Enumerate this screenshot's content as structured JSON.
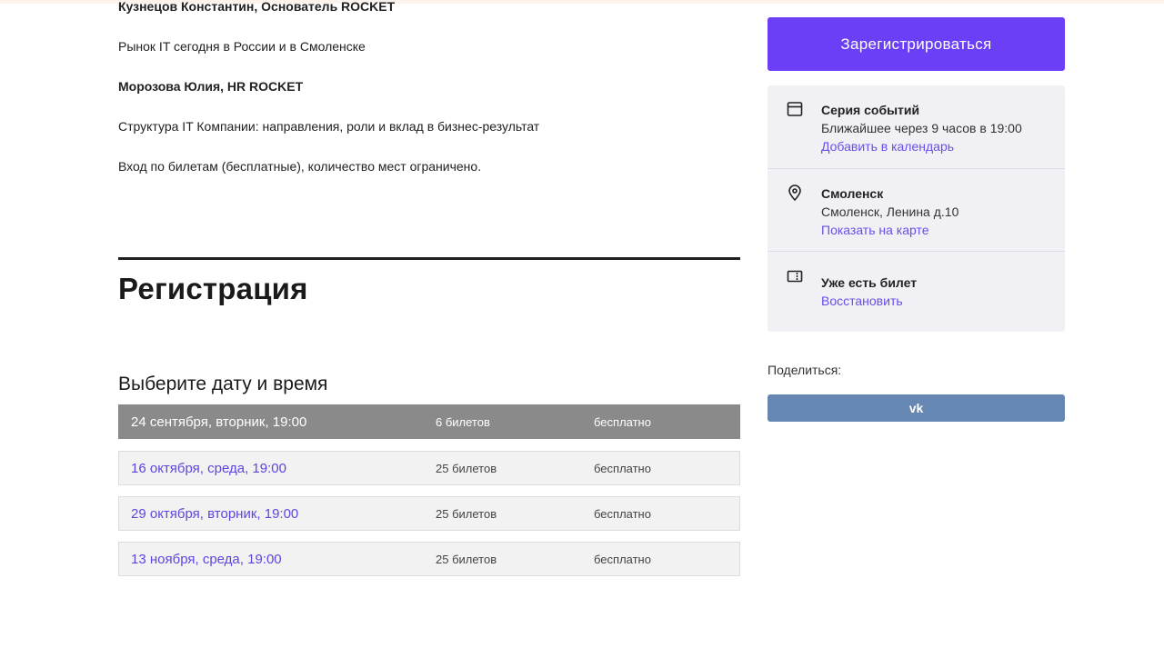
{
  "program": {
    "speaker1": "Кузнецов Константин, Основатель ROCKET",
    "talk1": "Рынок IT сегодня в России и в Смоленске",
    "speaker2": "Морозова Юлия, HR ROCKET",
    "talk2": "Структура IT Компании: направления, роли и вклад в бизнес-результат",
    "entry_note": "Вход по билетам (бесплатные), количество мест ограничено."
  },
  "registration": {
    "title": "Регистрация",
    "choose_label": "Выберите дату и время",
    "dates": [
      {
        "date": "24 сентября, вторник, 19:00",
        "tickets": "6 билетов",
        "price": "бесплатно",
        "selected": true
      },
      {
        "date": "16 октября, среда, 19:00",
        "tickets": "25 билетов",
        "price": "бесплатно",
        "selected": false
      },
      {
        "date": "29 октября, вторник, 19:00",
        "tickets": "25 билетов",
        "price": "бесплатно",
        "selected": false
      },
      {
        "date": "13 ноября, среда, 19:00",
        "tickets": "25 билетов",
        "price": "бесплатно",
        "selected": false
      }
    ]
  },
  "sidebar": {
    "register_button": "Зарегистрироваться",
    "series": {
      "title": "Серия событий",
      "subtitle": "Ближайшее через 9 часов в 19:00",
      "link": "Добавить в календарь",
      "icon": "calendar-icon"
    },
    "location": {
      "title": "Смоленск",
      "subtitle": "Смоленск, Ленина д.10",
      "link": "Показать на карте",
      "icon": "map-pin-icon"
    },
    "ticket": {
      "title": "Уже есть билет",
      "link": "Восстановить",
      "icon": "ticket-icon"
    },
    "share_label": "Поделиться:",
    "vk_label": "vk"
  },
  "colors": {
    "accent": "#6a3ff6",
    "link": "#6a4ee8",
    "selected_row": "#8a8a8a",
    "vk": "#6587b1"
  }
}
